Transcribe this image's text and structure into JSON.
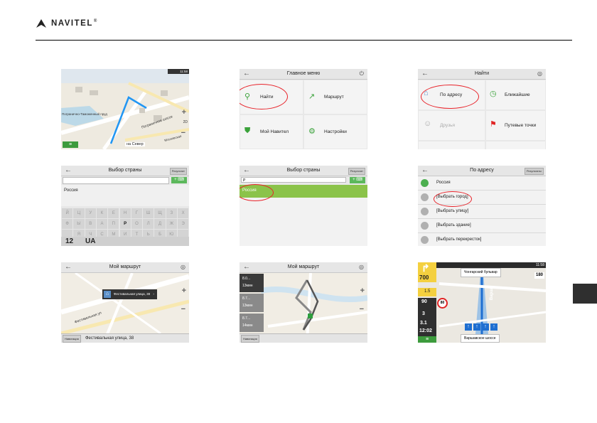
{
  "header": {
    "brand": "NAVITEL",
    "mark": "®"
  },
  "shots": {
    "map1": {
      "time": "11:58",
      "place": "Погранично-Таможенный пруд",
      "road1": "Пограничное шоссе",
      "road2": "Московская",
      "dest": "на Север",
      "sh": "2D"
    },
    "menu": {
      "title": "Главное меню",
      "items": [
        "Найти",
        "Маршрут",
        "Мой Навител",
        "Настройки"
      ]
    },
    "find": {
      "title": "Найти",
      "items": [
        "По адресу",
        "Ближайшие",
        "Друзья",
        "Путевые точки"
      ]
    },
    "country1": {
      "title": "Выбор страны",
      "btn": "Результат",
      "item": "Россия",
      "rows": [
        [
          "Й",
          "Ц",
          "У",
          "К",
          "Е",
          "Н",
          "Г",
          "Ш",
          "Щ",
          "З",
          "Х"
        ],
        [
          "Ф",
          "Ы",
          "В",
          "А",
          "П",
          "Р",
          "О",
          "Л",
          "Д",
          "Ж",
          "Э"
        ],
        [
          "",
          "Я",
          "Ч",
          "С",
          "М",
          "И",
          "Т",
          "Ь",
          "Б",
          "Ю",
          ""
        ]
      ],
      "k12": "12",
      "kua": "UA"
    },
    "country2": {
      "title": "Выбор страны",
      "btn": "Результат",
      "query": "Р",
      "item": "Россия"
    },
    "address": {
      "title": "По адресу",
      "btn": "Результаты",
      "items": [
        "Россия",
        "[Выбрать город]",
        "[Выбрать улицу]",
        "[Выбрать здание]",
        "[Выбрать перекресток]"
      ]
    },
    "route1": {
      "title": "Мой маршрут",
      "callout": "Фестивальная улица, 38",
      "street": "Фестивальная ул",
      "bottom_btn": "Навигация",
      "bottom": "Фестивальная улица, 38"
    },
    "route2": {
      "title": "Мой маршрут",
      "opts": [
        {
          "d": "8.0...",
          "t": "13мин"
        },
        {
          "d": "8.7...",
          "t": "13мин"
        },
        {
          "d": "8.7...",
          "t": "14мин"
        }
      ],
      "bottom_btn": "Навигация"
    },
    "nav": {
      "time": "11:58",
      "street": "Чонгарский бульвар",
      "d1": "700",
      "d2": "1.5",
      "s1": "90",
      "lim": "80",
      "r1": "3",
      "r2": "3.1",
      "eta": "12:02",
      "bat": "180",
      "bottom": "Варшавское шоссе",
      "vert": "Варш"
    }
  }
}
